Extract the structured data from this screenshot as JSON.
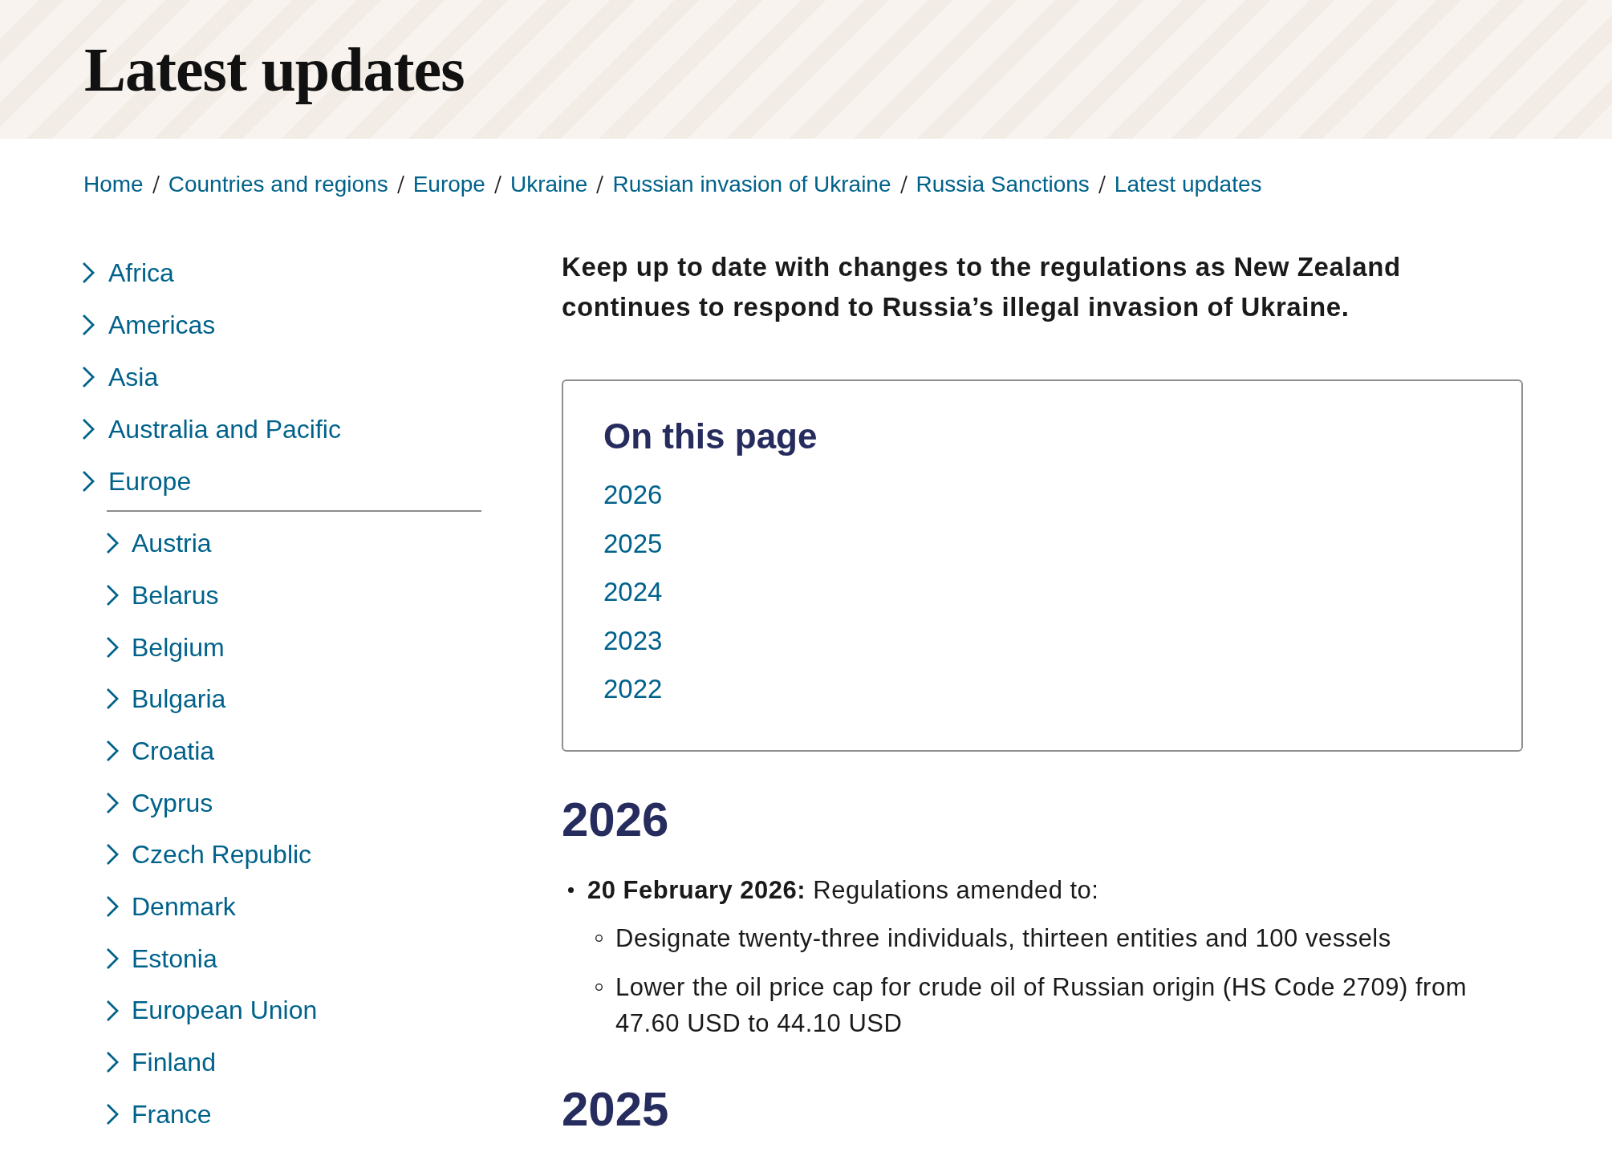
{
  "page_header": {
    "title": "Latest updates"
  },
  "breadcrumb": [
    {
      "label": "Home"
    },
    {
      "label": "Countries and regions"
    },
    {
      "label": "Europe"
    },
    {
      "label": "Ukraine"
    },
    {
      "label": "Russian invasion of Ukraine"
    },
    {
      "label": "Russia Sanctions"
    },
    {
      "label": "Latest updates"
    }
  ],
  "sidebar": {
    "items": [
      {
        "label": "Africa"
      },
      {
        "label": "Americas"
      },
      {
        "label": "Asia"
      },
      {
        "label": "Australia and Pacific"
      },
      {
        "label": "Europe",
        "children": [
          {
            "label": "Austria"
          },
          {
            "label": "Belarus"
          },
          {
            "label": "Belgium"
          },
          {
            "label": "Bulgaria"
          },
          {
            "label": "Croatia"
          },
          {
            "label": "Cyprus"
          },
          {
            "label": "Czech Republic"
          },
          {
            "label": "Denmark"
          },
          {
            "label": "Estonia"
          },
          {
            "label": "European Union"
          },
          {
            "label": "Finland"
          },
          {
            "label": "France"
          }
        ]
      }
    ]
  },
  "intro": "Keep up to date with changes to the regulations as New Zealand continues to respond to Russia’s illegal invasion of Ukraine.",
  "on_this_page": {
    "title": "On this page",
    "links": [
      "2026",
      "2025",
      "2024",
      "2023",
      "2022"
    ]
  },
  "sections": [
    {
      "heading": "2026",
      "items": [
        {
          "text": "**20 February 2026:** Regulations amended to:",
          "children": [
            {
              "text": "Designate twenty-three individuals, thirteen entities and 100 vessels"
            },
            {
              "text": "Lower the oil price cap for crude oil of Russian origin (HS Code 2709) from 47.60 USD to 44.10 USD"
            }
          ]
        }
      ]
    },
    {
      "heading": "2025"
    }
  ]
}
